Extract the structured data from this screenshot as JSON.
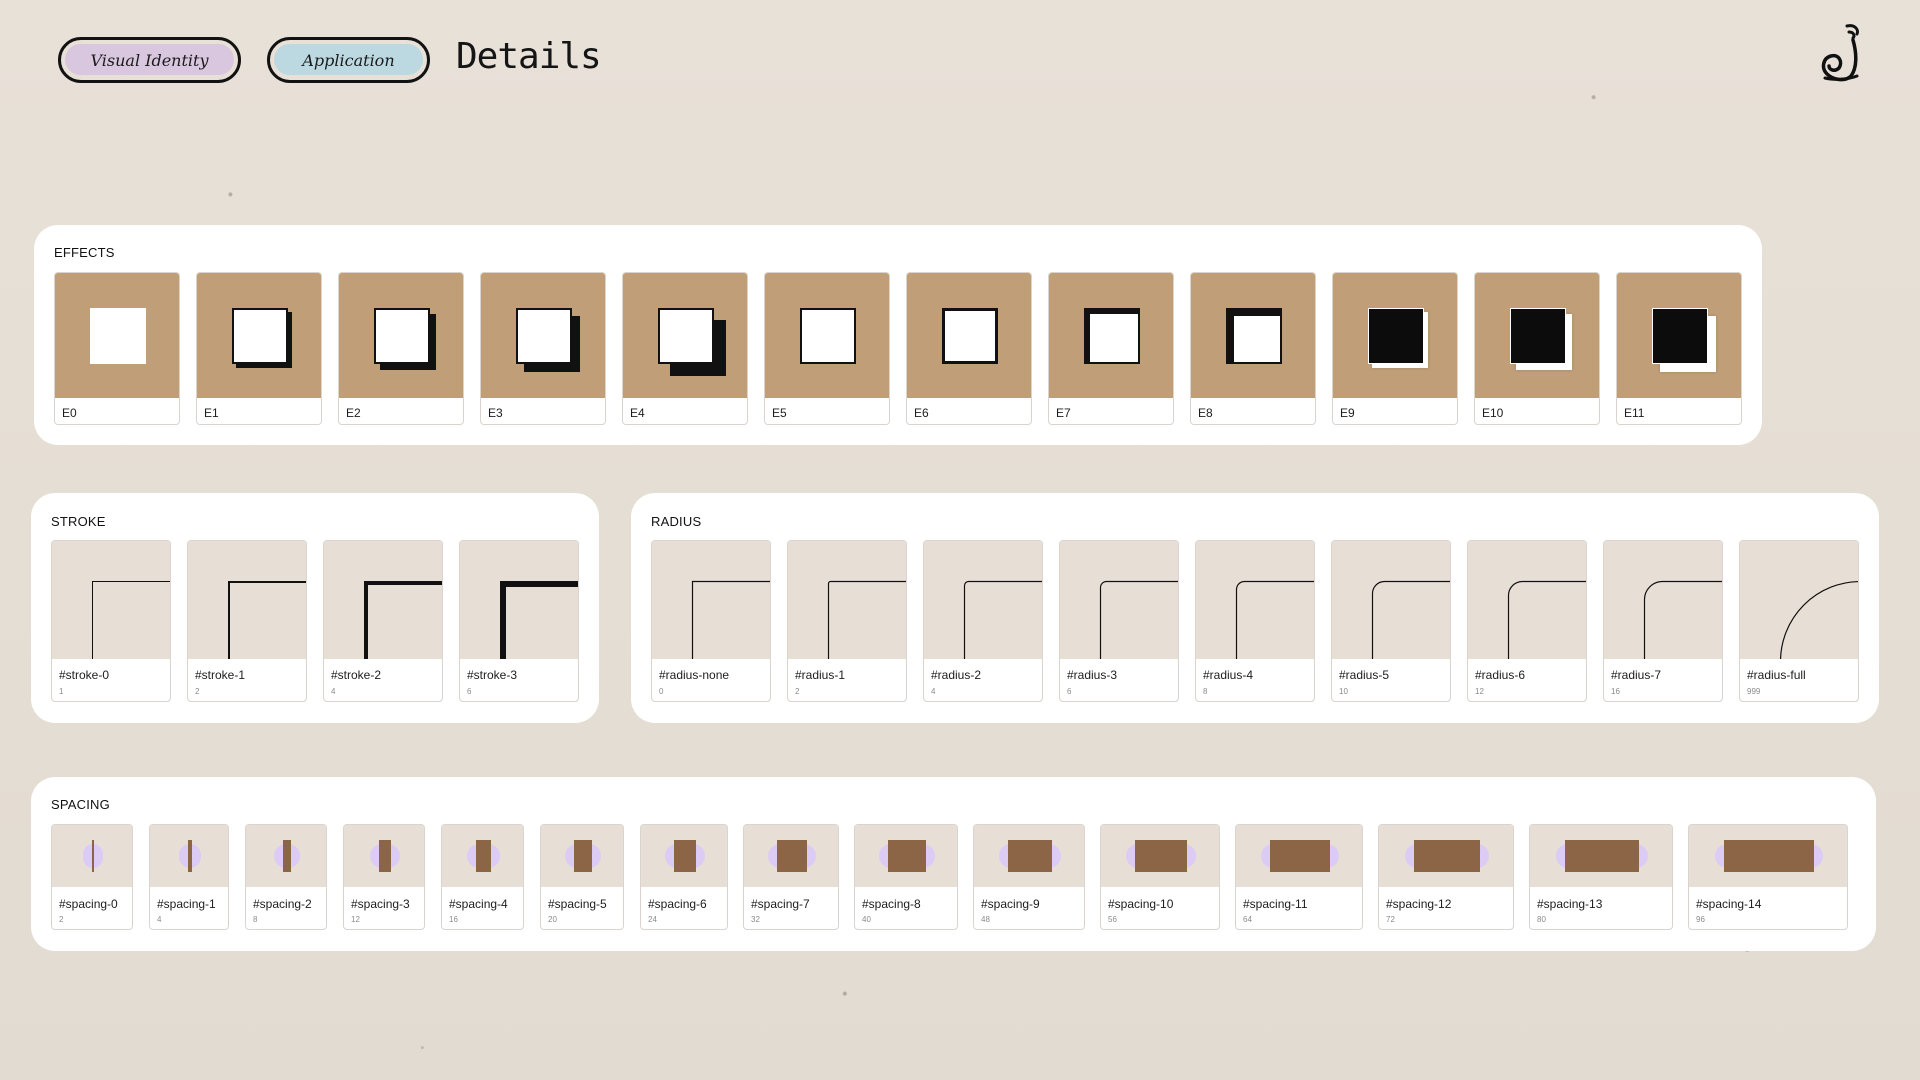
{
  "header": {
    "tabs": [
      {
        "label": "Visual Identity",
        "color": "#d9c7df"
      },
      {
        "label": "Application",
        "color": "#bcd9e2"
      }
    ],
    "title": "Details",
    "logo_icon": "snail-logo-icon"
  },
  "colors": {
    "background": "#e7e0d7",
    "effect_tile": "#bf9e78",
    "token_tile": "#e7dfd6",
    "spacing_bar": "#8b6546",
    "spacing_padding": "#dccbf4"
  },
  "effects": {
    "title": "EFFECTS",
    "items": [
      {
        "label": "E0",
        "style": "plain",
        "offset": 0,
        "shadow": 0,
        "fill": "white"
      },
      {
        "label": "E1",
        "style": "shadow",
        "offset": 0,
        "shadow": 4,
        "fill": "white"
      },
      {
        "label": "E2",
        "style": "shadow",
        "offset": 0,
        "shadow": 6,
        "fill": "white"
      },
      {
        "label": "E3",
        "style": "shadow",
        "offset": 0,
        "shadow": 8,
        "fill": "white"
      },
      {
        "label": "E4",
        "style": "shadow",
        "offset": 0,
        "shadow": 12,
        "fill": "white"
      },
      {
        "label": "E5",
        "style": "border",
        "border": 2,
        "fill": "white"
      },
      {
        "label": "E6",
        "style": "border",
        "border": 3,
        "fill": "white"
      },
      {
        "label": "E7",
        "style": "inset",
        "inset": 4,
        "fill": "white"
      },
      {
        "label": "E8",
        "style": "inset",
        "inset": 6,
        "fill": "white"
      },
      {
        "label": "E9",
        "style": "dark",
        "shadow": 4,
        "fill": "black"
      },
      {
        "label": "E10",
        "style": "dark",
        "shadow": 6,
        "fill": "black"
      },
      {
        "label": "E11",
        "style": "dark",
        "shadow": 8,
        "fill": "black"
      }
    ]
  },
  "stroke": {
    "title": "STROKE",
    "items": [
      {
        "name": "#stroke-0",
        "value": "1"
      },
      {
        "name": "#stroke-1",
        "value": "2"
      },
      {
        "name": "#stroke-2",
        "value": "4"
      },
      {
        "name": "#stroke-3",
        "value": "6"
      }
    ]
  },
  "radius": {
    "title": "RADIUS",
    "items": [
      {
        "name": "#radius-none",
        "value": "0"
      },
      {
        "name": "#radius-1",
        "value": "2"
      },
      {
        "name": "#radius-2",
        "value": "4"
      },
      {
        "name": "#radius-3",
        "value": "6"
      },
      {
        "name": "#radius-4",
        "value": "8"
      },
      {
        "name": "#radius-5",
        "value": "10"
      },
      {
        "name": "#radius-6",
        "value": "12"
      },
      {
        "name": "#radius-7",
        "value": "16"
      },
      {
        "name": "#radius-full",
        "value": "999"
      }
    ]
  },
  "spacing": {
    "title": "SPACING",
    "items": [
      {
        "name": "#spacing-0",
        "value": "2"
      },
      {
        "name": "#spacing-1",
        "value": "4"
      },
      {
        "name": "#spacing-2",
        "value": "8"
      },
      {
        "name": "#spacing-3",
        "value": "12"
      },
      {
        "name": "#spacing-4",
        "value": "16"
      },
      {
        "name": "#spacing-5",
        "value": "20"
      },
      {
        "name": "#spacing-6",
        "value": "24"
      },
      {
        "name": "#spacing-7",
        "value": "32"
      },
      {
        "name": "#spacing-8",
        "value": "40"
      },
      {
        "name": "#spacing-9",
        "value": "48"
      },
      {
        "name": "#spacing-10",
        "value": "56"
      },
      {
        "name": "#spacing-11",
        "value": "64"
      },
      {
        "name": "#spacing-12",
        "value": "72"
      },
      {
        "name": "#spacing-13",
        "value": "80"
      },
      {
        "name": "#spacing-14",
        "value": "96"
      }
    ]
  }
}
